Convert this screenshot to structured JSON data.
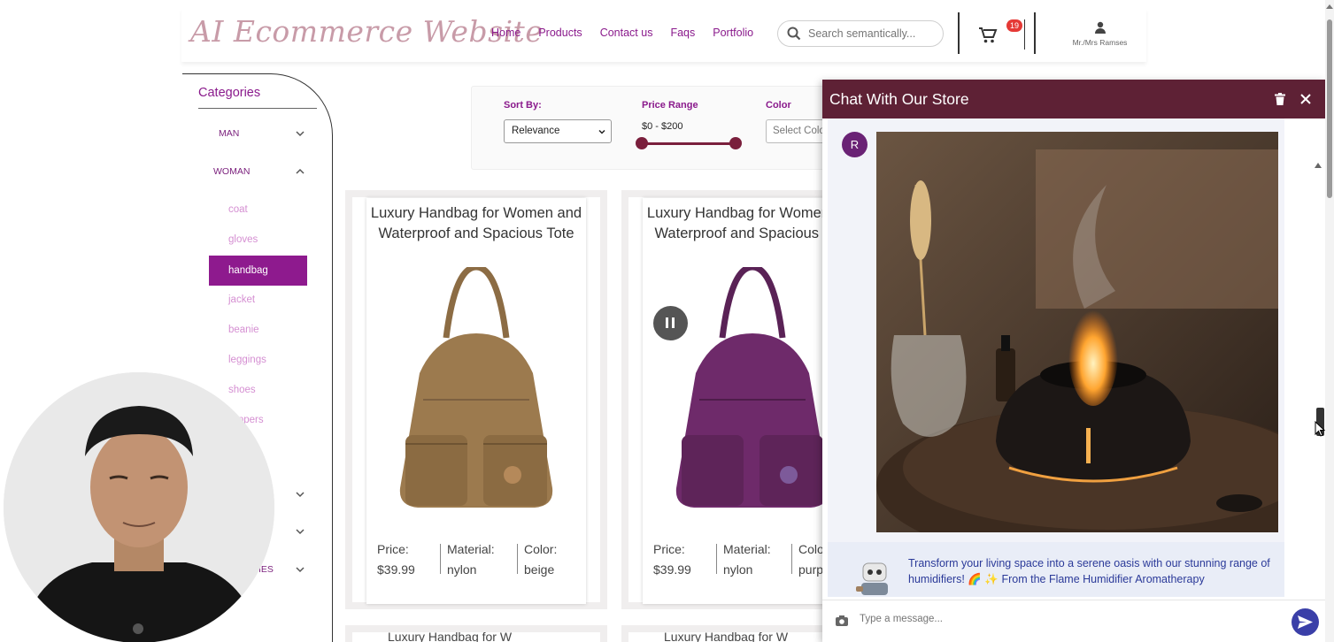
{
  "header": {
    "logo_text": "AI Ecommerce Website",
    "nav": [
      "Home",
      "Products",
      "Contact us",
      "Faqs",
      "Portfolio"
    ],
    "search_placeholder": "Search semantically...",
    "cart_count": "19",
    "user_label": "Mr./Mrs Ramses",
    "search_icon": "search-icon",
    "cart_icon": "cart-icon",
    "user_icon": "person-icon"
  },
  "sidebar": {
    "title": "Categories",
    "categories": [
      {
        "label": "MAN",
        "expanded": false
      },
      {
        "label": "WOMAN",
        "expanded": true
      }
    ],
    "woman_items": [
      "coat",
      "gloves",
      "handbag",
      "jacket",
      "beanie",
      "leggings",
      "shoes",
      "slippers"
    ],
    "active_item": "handbag",
    "partial_category_label": "IES"
  },
  "filters": {
    "sort_label": "Sort By:",
    "sort_value": "Relevance",
    "price_label": "Price Range",
    "price_value": "$0 - $200",
    "color_label": "Color",
    "color_placeholder": "Select Color"
  },
  "products": [
    {
      "title": "Luxury Handbag for Women and Waterproof and Spacious Tote",
      "price_label": "Price:",
      "price": "$39.99",
      "material_label": "Material:",
      "material": "nylon",
      "color_label": "Color:",
      "color": "beige",
      "bag_color": "#9c7a4e"
    },
    {
      "title": "Luxury Handbag for Women and Waterproof and Spacious Tote",
      "price_label": "Price:",
      "price": "$39.99",
      "material_label": "Material:",
      "material": "nylon",
      "color_label": "Color:",
      "color": "purple",
      "bag_color": "#6e2a6a"
    }
  ],
  "next_row_title_fragment": "Luxury Handbag for W",
  "chat": {
    "title": "Chat With Our Store",
    "avatar_letter": "R",
    "bot_message": "Transform your living space into a serene oasis with our stunning range of humidifiers! 🌈 ✨ From the Flame Humidifier Aromatherapy",
    "input_placeholder": "Type a message...",
    "delete_icon": "trash-icon",
    "close_icon": "close-icon",
    "camera_icon": "camera-icon",
    "send_icon": "send-icon"
  },
  "colors": {
    "brand_purple": "#8a1a8c",
    "chat_header": "#5e2135",
    "active_category": "#8e1a8e",
    "send_button": "#3a3fa8"
  }
}
